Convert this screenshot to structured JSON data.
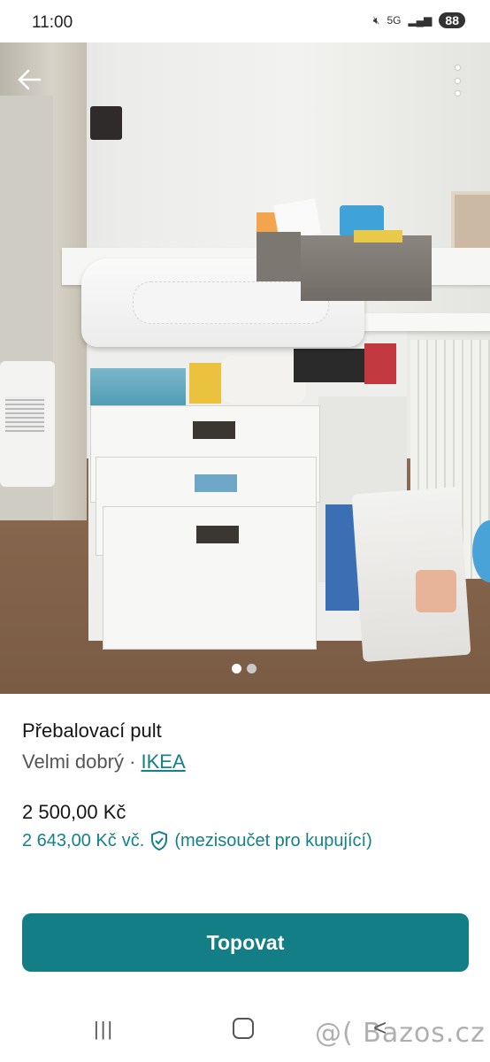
{
  "status_bar": {
    "time": "11:00",
    "battery": "88",
    "network": "5G"
  },
  "gallery": {
    "image_count": 2,
    "active_index": 0
  },
  "icons": {
    "back": "arrow-left-icon",
    "more": "more-vert-icon",
    "shield": "shield-check-icon"
  },
  "listing": {
    "title": "Přebalovací pult",
    "condition": "Velmi dobrý",
    "separator": " · ",
    "brand": "IKEA",
    "price": "2 500,00 Kč",
    "buyer_price": "2 643,00 Kč",
    "buyer_price_suffix": "vč.",
    "buyer_price_note": "(mezisoučet pro kupující)"
  },
  "actions": {
    "primary_button": "Topovat"
  },
  "nav_bar": {
    "recent_glyph": "|||",
    "back_glyph": "<"
  },
  "watermark": "@( Bazos.cz",
  "colors": {
    "accent": "#137e86",
    "text": "#161616",
    "muted": "#555555"
  }
}
